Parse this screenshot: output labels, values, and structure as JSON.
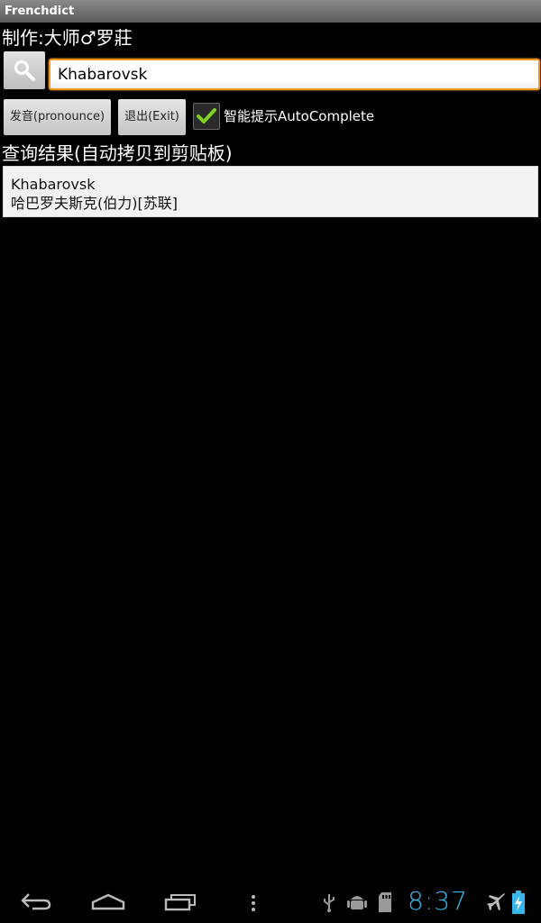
{
  "app": {
    "title": "Frenchdict",
    "author": "制作:大师♂罗莊"
  },
  "search": {
    "value": "Khabarovsk"
  },
  "buttons": {
    "pronounce": "发音(pronounce)",
    "exit": "退出(Exit)"
  },
  "autocomplete": {
    "label": "智能提示AutoComplete",
    "checked": true
  },
  "results": {
    "header": "查询结果(自动拷贝到剪贴板)",
    "items": [
      {
        "word": "Khabarovsk",
        "translation": "哈巴罗夫斯克(伯力)[苏联]"
      }
    ]
  },
  "status": {
    "clock": "8:37"
  },
  "colors": {
    "accent": "#f0961c",
    "clock": "#39b5e9",
    "check": "#7ed321"
  }
}
